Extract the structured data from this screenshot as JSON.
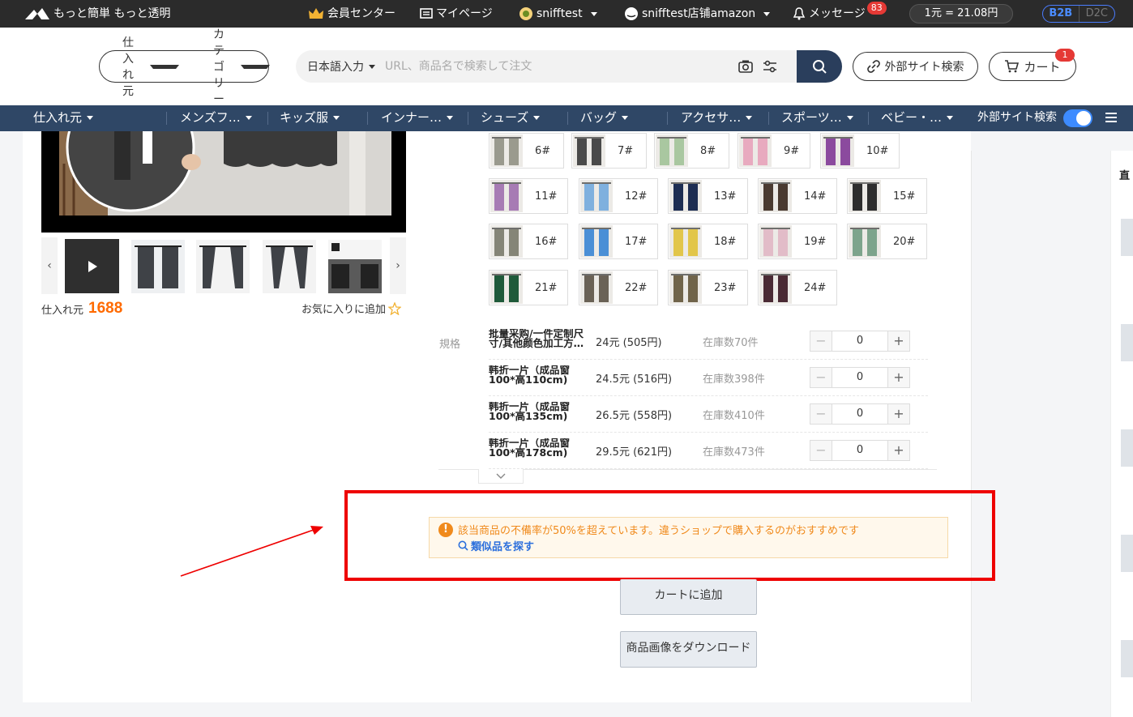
{
  "topbar": {
    "logo_text": "もっと簡単 もっと透明",
    "member_center": "会員センター",
    "mypage": "マイページ",
    "user": "snifftest",
    "shop": "snifftest店铺amazon",
    "messages": "メッセージ",
    "messages_count": "83",
    "rate": "1元 = 21.08円",
    "b2b": "B2B",
    "d2c": "D2C"
  },
  "header": {
    "source_select": "仕入れ元",
    "category_select": "カテゴリー",
    "lang_select": "日本語入力",
    "search_placeholder": "URL、商品名で検索して注文",
    "external_search": "外部サイト検索",
    "cart": "カート",
    "cart_count": "1"
  },
  "nav": {
    "items": [
      "仕入れ元",
      "メンズフ…",
      "キッズ服",
      "インナー…",
      "シューズ",
      "バッグ",
      "アクセサ…",
      "スポーツ…",
      "ベビー・…"
    ],
    "external_search": "外部サイト検索"
  },
  "product": {
    "source_label": "仕入れ元",
    "source_name": "1688",
    "favorite": "お気に入りに追加"
  },
  "colors": {
    "options": [
      "6#",
      "7#",
      "8#",
      "9#",
      "10#",
      "11#",
      "12#",
      "13#",
      "14#",
      "15#",
      "16#",
      "17#",
      "18#",
      "19#",
      "20#",
      "21#",
      "22#",
      "23#",
      "24#"
    ],
    "swatches": [
      "#9a9a8e",
      "#4a4a4a",
      "#a9c7a0",
      "#e8aabf",
      "#8b4a9e",
      "#a77bb4",
      "#7fb0de",
      "#1d2d52",
      "#4a3a30",
      "#2d2d2d",
      "#858577",
      "#4a8fd6",
      "#e2c64a",
      "#e2bcc8",
      "#7da48c",
      "#1f5a3a",
      "#6a6256",
      "#70644a",
      "#4a2a34"
    ]
  },
  "specs": {
    "label": "規格",
    "rows": [
      {
        "name": "批量采购/一件定制尺寸/其他颜色加工方…",
        "price": "24元 (505円)",
        "stock": "在庫数70件",
        "qty": "0"
      },
      {
        "name": "韩折一片（成品窗100*高110cm)",
        "price": "24.5元 (516円)",
        "stock": "在庫数398件",
        "qty": "0"
      },
      {
        "name": "韩折一片（成品窗100*高135cm)",
        "price": "26.5元 (558円)",
        "stock": "在庫数410件",
        "qty": "0"
      },
      {
        "name": "韩折一片（成品窗100*高178cm)",
        "price": "29.5元 (621円)",
        "stock": "在庫数473件",
        "qty": "0"
      }
    ]
  },
  "warning": {
    "text": "該当商品の不備率が50%を超えています。違うショップで購入するのがおすすめです",
    "link": "類似品を探す"
  },
  "actions": {
    "add_to_cart": "カートに追加",
    "download_images": "商品画像をダウンロード"
  },
  "right_col_label": "直"
}
